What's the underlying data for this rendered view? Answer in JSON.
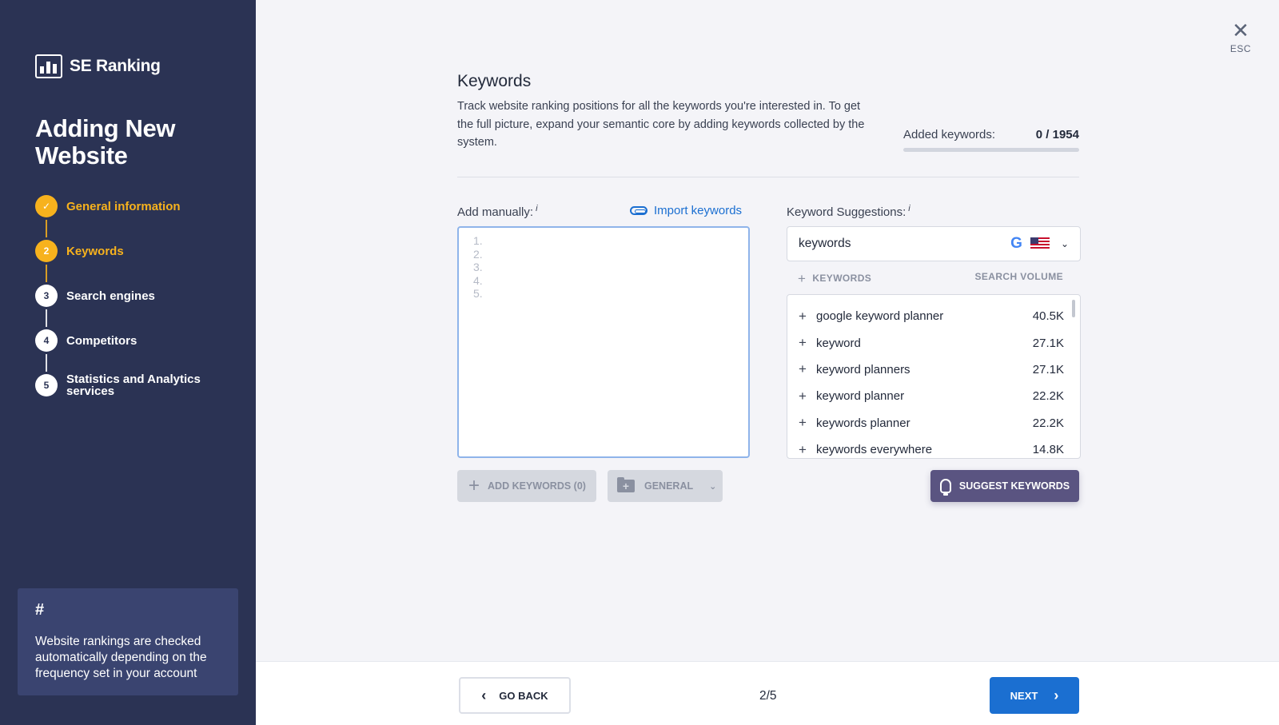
{
  "app": {
    "logo_text": "SE Ranking"
  },
  "wizard": {
    "title_line1": "Adding New",
    "title_line2": "Website",
    "steps": [
      {
        "number": "✓",
        "label": "General information",
        "state": "done"
      },
      {
        "number": "2",
        "label": "Keywords",
        "state": "active"
      },
      {
        "number": "3",
        "label": "Search engines",
        "state": "pending"
      },
      {
        "number": "4",
        "label": "Competitors",
        "state": "pending"
      },
      {
        "number": "5",
        "label_line1": "Statistics and Analytics",
        "label_line2": "services",
        "state": "pending"
      }
    ],
    "tip": {
      "hash": "#",
      "text": "Website rankings are checked automatically depending on the frequency set in your account"
    }
  },
  "close": {
    "label": "ESC",
    "icon": "close-icon"
  },
  "main": {
    "title": "Keywords",
    "description": "Track website ranking positions for all the keywords you're interested in. To get the full picture, expand your semantic core by adding keywords collected by the system.",
    "added_label": "Added keywords:",
    "added_count": "0 / 1954",
    "added_progress": 0
  },
  "manual": {
    "label": "Add manually:",
    "info": "i",
    "import_link": "Import keywords",
    "line_numbers": [
      "1.",
      "2.",
      "3.",
      "4.",
      "5."
    ],
    "add_button": "ADD KEYWORDS (0)",
    "group_button": "GENERAL"
  },
  "suggestions": {
    "label": "Keyword Suggestions:",
    "info": "i",
    "search_value": "keywords",
    "engine_icon": "google-icon",
    "region_icon": "us-flag-icon",
    "col_keywords": "KEYWORDS",
    "col_volume": "SEARCH VOLUME",
    "items": [
      {
        "keyword": "google keyword planner",
        "volume": "40.5K"
      },
      {
        "keyword": "keyword",
        "volume": "27.1K"
      },
      {
        "keyword": "keyword planners",
        "volume": "27.1K"
      },
      {
        "keyword": "keyword planner",
        "volume": "22.2K"
      },
      {
        "keyword": "keywords planner",
        "volume": "22.2K"
      },
      {
        "keyword": "keywords everywhere",
        "volume": "14.8K"
      }
    ],
    "suggest_button": "SUGGEST KEYWORDS"
  },
  "footer": {
    "back_label": "GO BACK",
    "page_indicator": "2/5",
    "next_label": "NEXT"
  },
  "colors": {
    "sidebar_bg": "#2b3354",
    "accent_yellow": "#f7b21d",
    "primary_blue": "#1b6fd1",
    "suggest_purple": "#5a5481"
  }
}
